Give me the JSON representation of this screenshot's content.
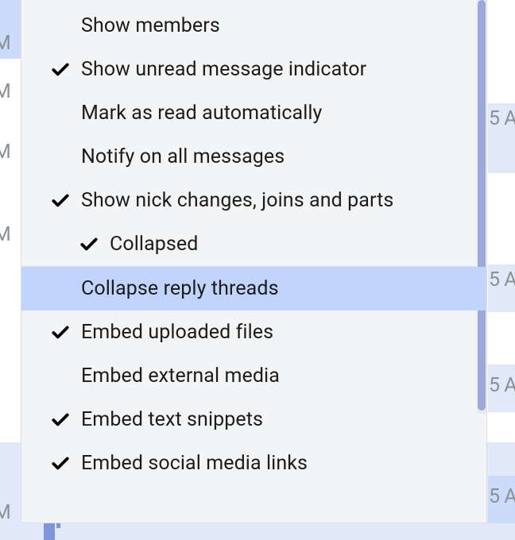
{
  "background": {
    "times": [
      "M",
      "M",
      "M",
      "M",
      "M",
      "5 A",
      "5 A",
      "5 A",
      "5 A"
    ]
  },
  "menu": {
    "items": [
      {
        "label": "Show members",
        "checked": false,
        "sub": false,
        "highlight": false,
        "name": "menu-item-show-members"
      },
      {
        "label": "Show unread message indicator",
        "checked": true,
        "sub": false,
        "highlight": false,
        "name": "menu-item-show-unread-indicator"
      },
      {
        "label": "Mark as read automatically",
        "checked": false,
        "sub": false,
        "highlight": false,
        "name": "menu-item-mark-as-read-auto"
      },
      {
        "label": "Notify on all messages",
        "checked": false,
        "sub": false,
        "highlight": false,
        "name": "menu-item-notify-all-messages"
      },
      {
        "label": "Show nick changes, joins and parts",
        "checked": true,
        "sub": false,
        "highlight": false,
        "name": "menu-item-show-nick-changes"
      },
      {
        "label": "Collapsed",
        "checked": true,
        "sub": true,
        "highlight": false,
        "name": "menu-subitem-collapsed"
      },
      {
        "label": "Collapse reply threads",
        "checked": false,
        "sub": false,
        "highlight": true,
        "name": "menu-item-collapse-reply-threads"
      },
      {
        "label": "Embed uploaded files",
        "checked": true,
        "sub": false,
        "highlight": false,
        "name": "menu-item-embed-uploaded-files"
      },
      {
        "label": "Embed external media",
        "checked": false,
        "sub": false,
        "highlight": false,
        "name": "menu-item-embed-external-media"
      },
      {
        "label": "Embed text snippets",
        "checked": true,
        "sub": false,
        "highlight": false,
        "name": "menu-item-embed-text-snippets"
      },
      {
        "label": "Embed social media links",
        "checked": true,
        "sub": false,
        "highlight": false,
        "name": "menu-item-embed-social-media"
      }
    ]
  }
}
